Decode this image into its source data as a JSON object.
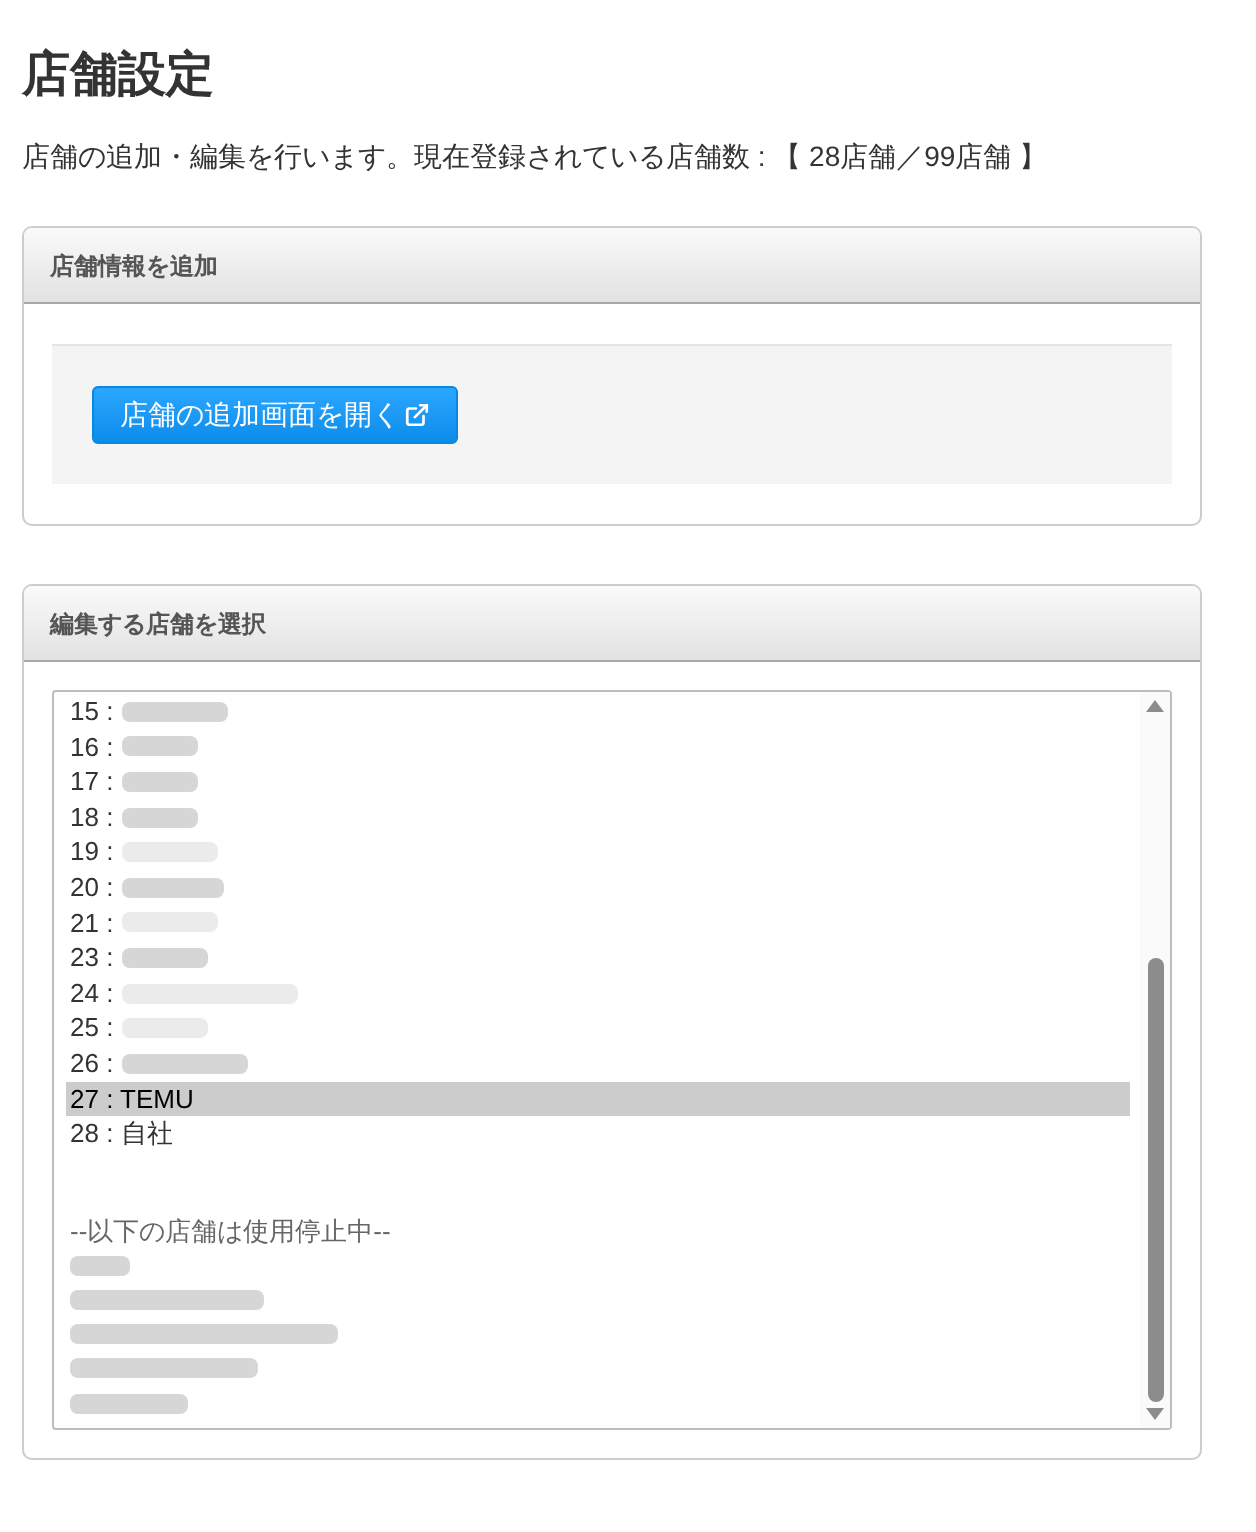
{
  "page": {
    "title": "店舗設定",
    "description": "店舗の追加・編集を行います。現在登録されている店舗数 : 【 28店舗／99店舗 】"
  },
  "add_panel": {
    "title": "店舗情報を追加",
    "button": "店舗の追加画面を開く"
  },
  "select_panel": {
    "title": "編集する店舗を選択",
    "options": [
      {
        "kind": "redacted",
        "label": "15 :",
        "selected": false
      },
      {
        "kind": "redacted",
        "label": "16 :",
        "selected": false
      },
      {
        "kind": "redacted",
        "label": "17 :",
        "selected": false
      },
      {
        "kind": "redacted",
        "label": "18 :",
        "selected": false
      },
      {
        "kind": "redacted",
        "label": "19 :",
        "selected": false
      },
      {
        "kind": "redacted",
        "label": "20 :",
        "selected": false
      },
      {
        "kind": "redacted",
        "label": "21 :",
        "selected": false
      },
      {
        "kind": "redacted",
        "label": "23 :",
        "selected": false
      },
      {
        "kind": "redacted",
        "label": "24 :",
        "selected": false
      },
      {
        "kind": "redacted",
        "label": "25 :",
        "selected": false
      },
      {
        "kind": "redacted",
        "label": "26 :",
        "selected": false
      },
      {
        "kind": "named",
        "label": "27 : TEMU",
        "selected": true
      },
      {
        "kind": "named",
        "label": "28 : 自社",
        "selected": false
      }
    ],
    "inactive_heading": "--以下の店舗は使用停止中--",
    "inactive_options": [
      {
        "selected": false
      },
      {
        "selected": false
      },
      {
        "selected": false
      },
      {
        "selected": false
      },
      {
        "selected": false
      }
    ]
  }
}
